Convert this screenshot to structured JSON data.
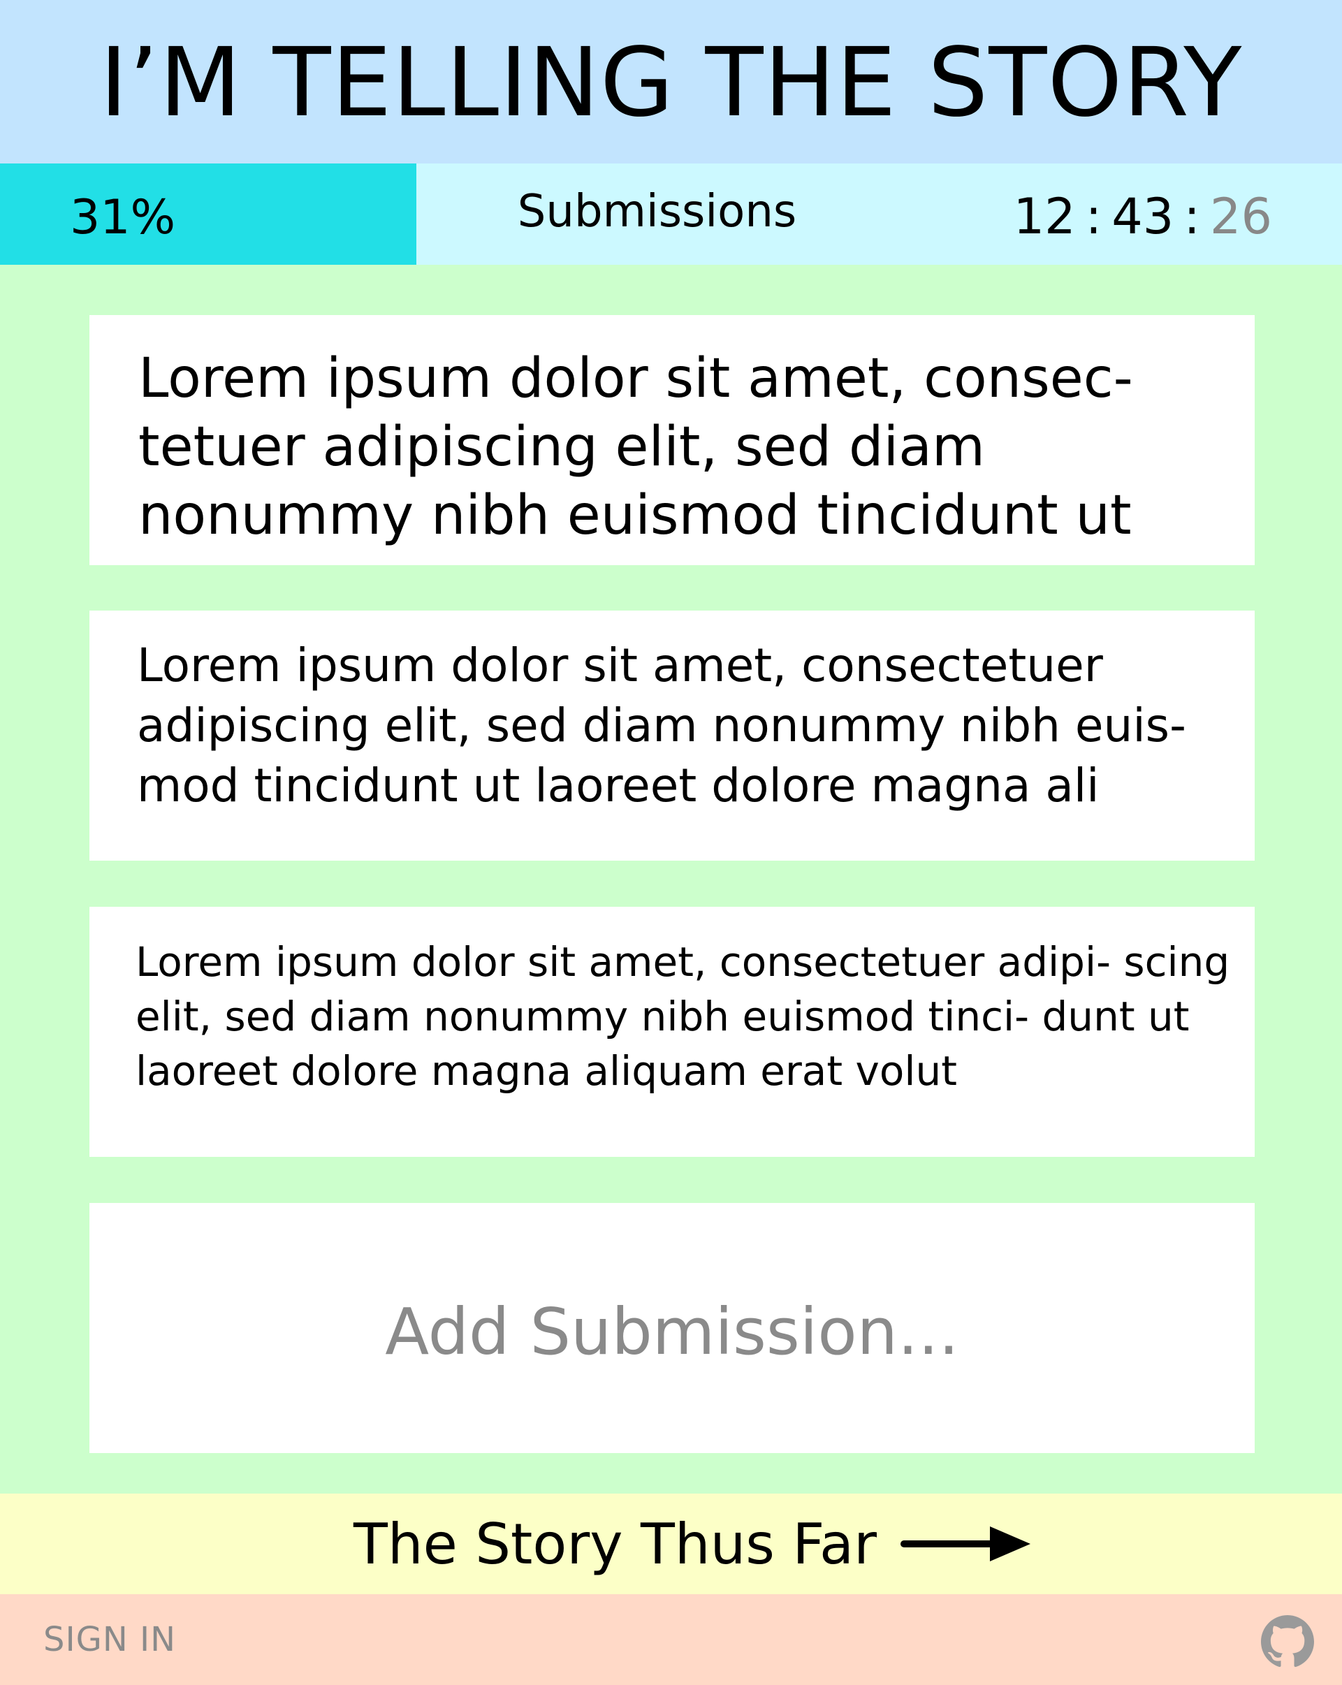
{
  "header": {
    "title": "I’M TELLING THE STORY"
  },
  "status": {
    "progress_label": "31%",
    "progress_fraction": 0.31,
    "title": "Submissions",
    "timer": {
      "hours": "12",
      "minutes": "43",
      "seconds": "26",
      "separator": ":"
    }
  },
  "submissions": [
    {
      "text": "Lorem ipsum dolor sit amet, consec- tetuer adipiscing elit, sed diam nonummy nibh euismod tincidunt ut"
    },
    {
      "text": "Lorem ipsum dolor sit amet, consectetuer adipiscing elit, sed diam nonummy nibh euis- mod tincidunt ut laoreet dolore magna ali"
    },
    {
      "text": "Lorem ipsum dolor sit amet, consectetuer adipi- scing elit, sed diam nonummy nibh euismod tinci- dunt ut laoreet dolore magna aliquam erat volut"
    }
  ],
  "add_submission": {
    "placeholder": "Add Submission..."
  },
  "story_link": {
    "label": "The Story Thus Far",
    "icon": "arrow-right-icon"
  },
  "footer": {
    "signin_label": "SIGN IN",
    "github_icon": "github-icon"
  },
  "colors": {
    "header_bg": "#c2e4fe",
    "status_bg": "#ccf9ff",
    "progress_fill": "#22dfe6",
    "main_bg": "#ccffcc",
    "story_bar_bg": "#fcffc7",
    "footer_bg": "#ffd9c7"
  }
}
